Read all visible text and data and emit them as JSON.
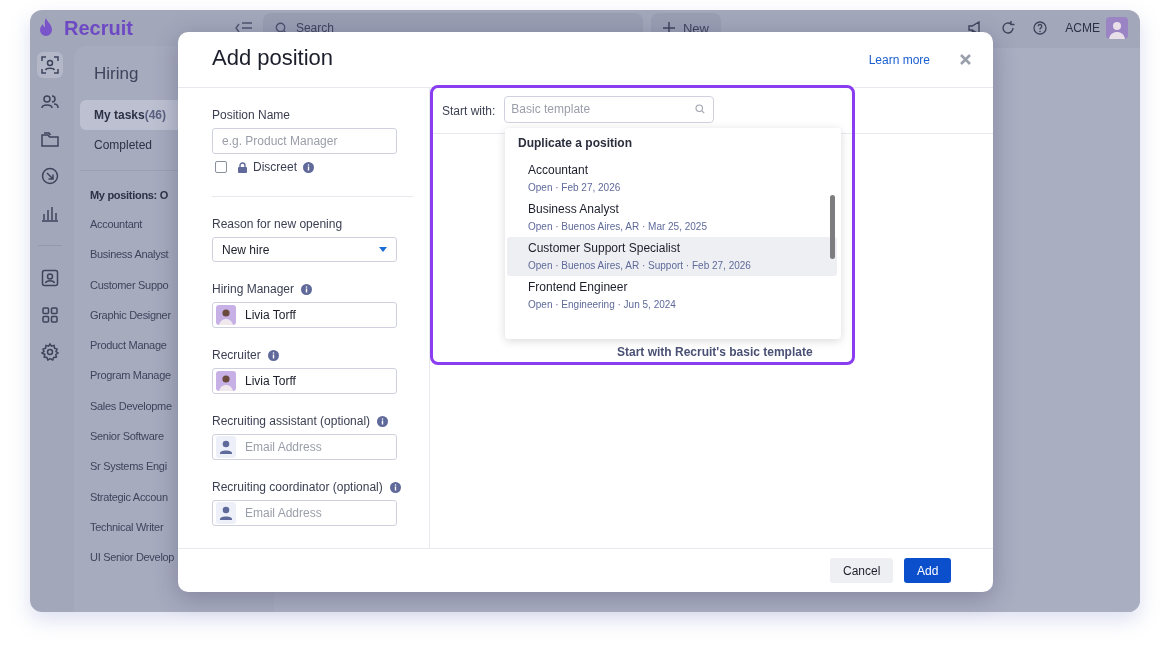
{
  "app": {
    "logo": "Recruit",
    "search_placeholder": "Search",
    "new_button": "New",
    "account": "ACME"
  },
  "rail": [
    {
      "selected": true
    },
    {
      "selected": false
    },
    {
      "selected": false
    },
    {
      "selected": false
    },
    {
      "selected": false
    },
    {
      "selected": false
    },
    {
      "selected": false
    },
    {
      "selected": false
    }
  ],
  "nav": {
    "title": "Hiring",
    "tasks": [
      {
        "label": "My tasks",
        "count": "(46)",
        "selected": true
      },
      {
        "label": "Completed",
        "selected": false
      }
    ],
    "section": "My positions: O",
    "positions": [
      "Accountant",
      "Business Analyst",
      "Customer Suppo",
      "Graphic Designer",
      "Product Manage",
      "Program Manage",
      "Sales Developme",
      "Senior Software",
      "Sr Systems Engi",
      "Strategic Accoun",
      "Technical Writer",
      "UI Senior Develop"
    ]
  },
  "modal": {
    "title": "Add position",
    "learn_more": "Learn more",
    "fields": [
      {
        "kind": "text",
        "label": "Position Name",
        "info": false,
        "placeholder": "e.g. Product Manager",
        "checkbox": {
          "label": "Discreet",
          "checked": false,
          "info": true
        }
      },
      {
        "kind": "select",
        "label": "Reason for new opening",
        "info": false,
        "value": "New hire"
      },
      {
        "kind": "person",
        "label": "Hiring Manager",
        "info": true,
        "value": "Livia Torff"
      },
      {
        "kind": "person",
        "label": "Recruiter",
        "info": true,
        "value": "Livia Torff"
      },
      {
        "kind": "email",
        "label": "Recruiting assistant (optional)",
        "info": true,
        "placeholder": "Email Address"
      },
      {
        "kind": "email",
        "label": "Recruiting coordinator (optional)",
        "info": true,
        "placeholder": "Email Address"
      }
    ],
    "template": {
      "label": "Start with:",
      "placeholder": "Basic template",
      "heading": "Duplicate a position",
      "basic": "Start with Recruit's basic template",
      "items": [
        {
          "name": "Accountant",
          "meta": "Open · Feb 27, 2026",
          "selected": false
        },
        {
          "name": "Business Analyst",
          "meta": "Open · Buenos Aires, AR · Mar 25, 2025",
          "selected": false
        },
        {
          "name": "Customer Support Specialist",
          "meta": "Open · Buenos Aires, AR · Support · Feb 27, 2026",
          "selected": true
        },
        {
          "name": "Frontend Engineer",
          "meta": "Open · Engineering · Jun 5, 2024",
          "selected": false
        }
      ]
    },
    "buttons": {
      "cancel": "Cancel",
      "add": "Add"
    }
  }
}
